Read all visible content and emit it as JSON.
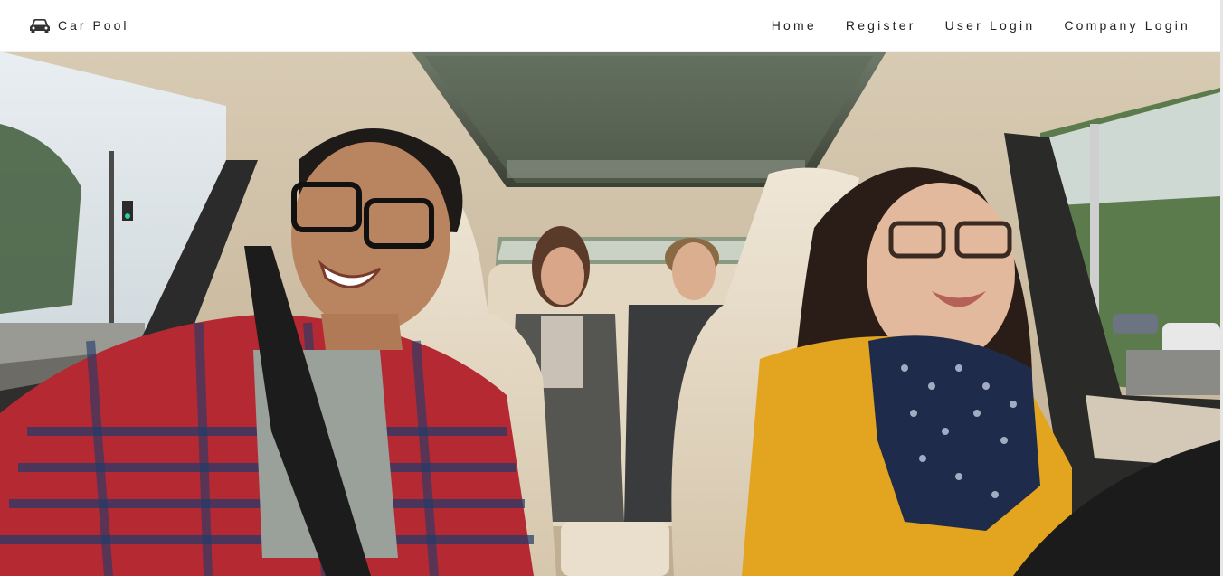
{
  "navbar": {
    "brand": {
      "icon": "car-icon",
      "label": "Car Pool"
    },
    "links": [
      {
        "label": "Home"
      },
      {
        "label": "Register"
      },
      {
        "label": "User Login"
      },
      {
        "label": "Company Login"
      }
    ]
  },
  "hero": {
    "image": "car-interior-carpool-photo"
  },
  "colors": {
    "navbar_bg": "#ffffff",
    "text": "#222222"
  }
}
